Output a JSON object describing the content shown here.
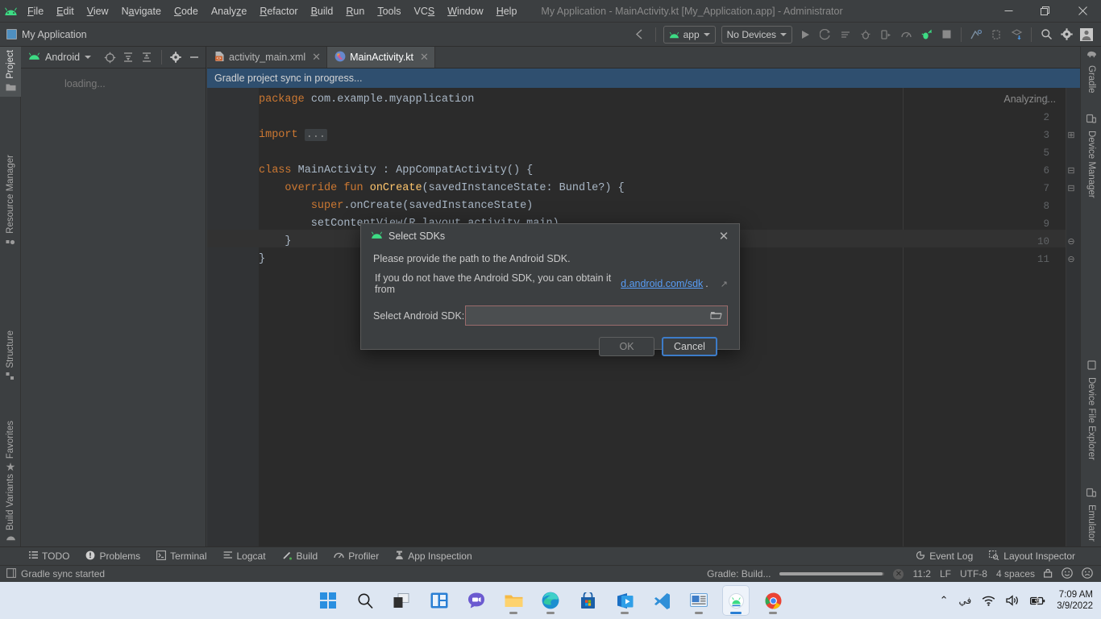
{
  "window": {
    "title": "My Application - MainActivity.kt [My_Application.app] - Administrator",
    "minimize": "—",
    "maximize": "❐",
    "close": "✕"
  },
  "menu": {
    "items": [
      "File",
      "Edit",
      "View",
      "Navigate",
      "Code",
      "Analyze",
      "Refactor",
      "Build",
      "Run",
      "Tools",
      "VCS",
      "Window",
      "Help"
    ]
  },
  "navbar": {
    "breadcrumb": "My Application",
    "module_selector": "app",
    "device_selector": "No Devices"
  },
  "left_strip": {
    "items": [
      {
        "label": "Project",
        "icon": "folder-icon",
        "selected": true
      },
      {
        "label": "Resource Manager",
        "icon": "resource-icon",
        "selected": false
      },
      {
        "label": "Structure",
        "icon": "structure-icon",
        "selected": false
      },
      {
        "label": "Favorites",
        "icon": "star-icon",
        "selected": false
      },
      {
        "label": "Build Variants",
        "icon": "android-icon",
        "selected": false
      }
    ]
  },
  "right_strip": {
    "items": [
      {
        "label": "Gradle",
        "icon": "gradle-elephant-icon"
      },
      {
        "label": "Device Manager",
        "icon": "device-manager-icon"
      },
      {
        "label": "Device File Explorer",
        "icon": "device-file-icon"
      },
      {
        "label": "Emulator",
        "icon": "emulator-icon"
      }
    ]
  },
  "project_panel": {
    "title": "Android",
    "loading": "loading..."
  },
  "editor_tabs": [
    {
      "label": "activity_main.xml",
      "icon": "xml-file-icon",
      "active": false,
      "close": "✕"
    },
    {
      "label": "MainActivity.kt",
      "icon": "kotlin-file-icon",
      "active": true,
      "close": "✕"
    }
  ],
  "sync_banner": {
    "message": "Gradle project sync in progress..."
  },
  "editor": {
    "analyzing": "Analyzing...",
    "line_numbers": [
      "1",
      "2",
      "3",
      "5",
      "6",
      "7",
      "8",
      "9",
      "10",
      "11"
    ],
    "current_line_index": 8,
    "lines": [
      {
        "n": "1",
        "fold": "",
        "html": "<span class=\"kw\">package</span> com.example.myapplication"
      },
      {
        "n": "2",
        "fold": "",
        "html": ""
      },
      {
        "n": "3",
        "fold": "⊞",
        "html": "<span class=\"kw\">import</span> <span class=\"fold-ellipsis\">...</span>"
      },
      {
        "n": "5",
        "fold": "",
        "html": ""
      },
      {
        "n": "6",
        "fold": "⊟",
        "html": "<span class=\"kw\">class</span> MainActivity : AppCompatActivity() {"
      },
      {
        "n": "7",
        "fold": "⊟",
        "html": "    <span class=\"kw\">override fun</span> <span class=\"fn\">onCreate</span>(savedInstanceState: Bundle?) {"
      },
      {
        "n": "8",
        "fold": "",
        "html": "        <span class=\"kw\">super</span>.onCreate(savedInstanceState)"
      },
      {
        "n": "9",
        "fold": "",
        "html": "        setContentView(R.layout.activity_main)"
      },
      {
        "n": "10",
        "fold": "⊖",
        "html": "    }"
      },
      {
        "n": "11",
        "fold": "⊖",
        "html": "}"
      }
    ]
  },
  "dialog": {
    "title": "Select SDKs",
    "icon": "android-icon",
    "close": "✕",
    "paragraph1": "Please provide the path to the Android SDK.",
    "paragraph2_prefix": "If you do not have the Android SDK, you can obtain it from ",
    "paragraph2_link": "d.android.com/sdk",
    "paragraph2_suffix": ".",
    "external_link_icon": "↗",
    "field_label": "Select Android SDK:",
    "field_value": "",
    "field_placeholder": "",
    "browse_icon": "folder-open-icon",
    "ok_label": "OK",
    "cancel_label": "Cancel"
  },
  "bottom_bar": {
    "items": [
      {
        "label": "TODO",
        "icon": "todo-icon"
      },
      {
        "label": "Problems",
        "icon": "problems-icon"
      },
      {
        "label": "Terminal",
        "icon": "terminal-icon"
      },
      {
        "label": "Logcat",
        "icon": "logcat-icon"
      },
      {
        "label": "Build",
        "icon": "build-hammer-icon"
      },
      {
        "label": "Profiler",
        "icon": "profiler-icon"
      },
      {
        "label": "App Inspection",
        "icon": "app-inspection-icon"
      }
    ],
    "right_items": [
      {
        "label": "Event Log",
        "icon": "event-log-icon"
      },
      {
        "label": "Layout Inspector",
        "icon": "layout-inspector-icon"
      }
    ]
  },
  "status_bar": {
    "message": "Gradle sync started",
    "task": "Gradle: Build...",
    "progress_percent": 98,
    "caret_position": "11:2",
    "line_separator": "LF",
    "encoding": "UTF-8",
    "indent": "4 spaces",
    "lock_icon": "lock-icon",
    "happy_icon": "happy-face-icon",
    "sad_icon": "sad-face-icon"
  },
  "taskbar": {
    "apps": [
      {
        "name": "start-button",
        "running": false
      },
      {
        "name": "search-icon",
        "running": false
      },
      {
        "name": "task-view-icon",
        "running": false
      },
      {
        "name": "widgets-icon",
        "running": false
      },
      {
        "name": "chat-icon",
        "running": false
      },
      {
        "name": "file-explorer-icon",
        "running": true
      },
      {
        "name": "edge-browser-icon",
        "running": true
      },
      {
        "name": "microsoft-store-icon",
        "running": false
      },
      {
        "name": "media-player-icon",
        "running": true
      },
      {
        "name": "vs-code-icon",
        "running": false
      },
      {
        "name": "presentation-app-icon",
        "running": true
      },
      {
        "name": "android-studio-icon",
        "running": true
      },
      {
        "name": "chrome-icon",
        "running": true
      }
    ],
    "tray": {
      "chevron": "⌃",
      "language": "في",
      "wifi_icon": "wifi-icon",
      "volume_icon": "volume-icon",
      "battery_icon": "battery-charging-icon",
      "time": "7:09 AM",
      "date": "3/9/2022"
    }
  },
  "colors": {
    "chrome": "#3c3f41",
    "editor_bg": "#2b2b2b",
    "sync_banner": "#2f4f6f",
    "accent_blue": "#3d7cc9",
    "link_blue": "#589df6",
    "keyword_orange": "#cc7832",
    "function_yellow": "#ffc66d",
    "error_border": "#9a6b6b",
    "android_green": "#3ddc84",
    "taskbar_bg": "#dde6f2"
  }
}
